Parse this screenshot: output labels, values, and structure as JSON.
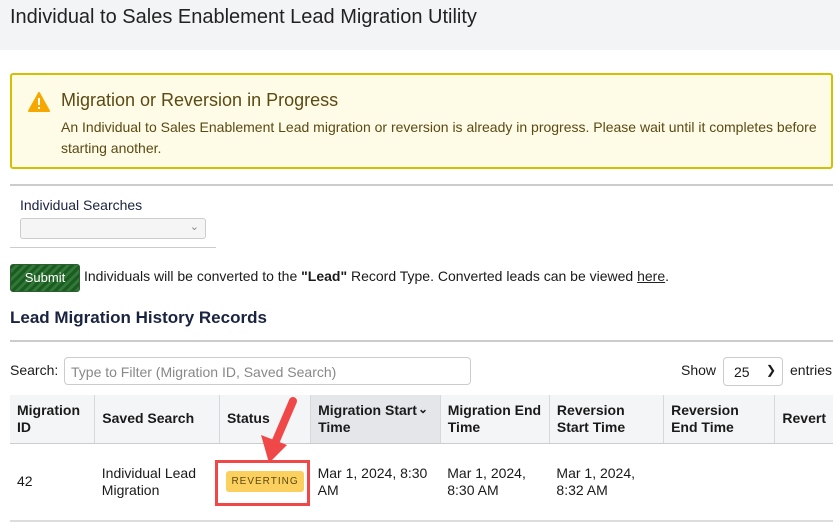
{
  "header": {
    "title": "Individual to Sales Enablement Lead Migration Utility"
  },
  "alert": {
    "icon": "warning-triangle-icon",
    "title": "Migration or Reversion in Progress",
    "message": "An Individual to Sales Enablement Lead migration or reversion is already in progress. Please wait until it completes before starting another."
  },
  "form": {
    "label": "Individual Searches",
    "selected": "",
    "submit": "Submit",
    "note_pre": "Individuals will be converted to the ",
    "note_bold": "\"Lead\"",
    "note_mid": " Record Type. Converted leads can be viewed ",
    "note_link": "here",
    "note_post": "."
  },
  "history": {
    "title": "Lead Migration History Records",
    "search_label": "Search:",
    "search_placeholder": "Type to Filter (Migration ID, Saved Search)",
    "show": "Show",
    "entries_value": "25",
    "entries": "entries",
    "columns": [
      "Migration ID",
      "Saved Search",
      "Status",
      "Migration Start Time",
      "Migration End Time",
      "Reversion Start Time",
      "Reversion End Time",
      "Revert"
    ],
    "rows": [
      {
        "id": "42",
        "saved_search": "Individual Lead Migration",
        "status": "REVERTING",
        "migration_start": "Mar 1, 2024, 8:30 AM",
        "migration_end": "Mar 1, 2024, 8:30 AM",
        "reversion_start": "Mar 1, 2024, 8:32 AM",
        "reversion_end": "",
        "revert": ""
      }
    ]
  },
  "colors": {
    "alert_border": "#d1c100",
    "badge": "#fcd05e",
    "annotation": "#f04848",
    "submit": "#1e5a24"
  }
}
